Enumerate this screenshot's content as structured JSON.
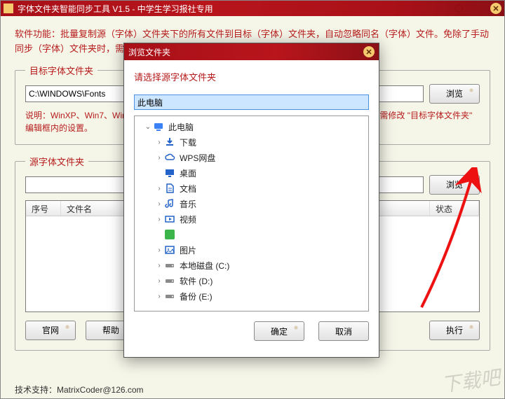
{
  "window": {
    "title": "字体文件夹智能同步工具 V1.5 - 中学生学习报社专用",
    "description": "软件功能：批量复制源（字体）文件夹下的所有文件到目标（字体）文件夹，自动忽略同名（字体）文件。免除了手动同步（字体）文件夹时，需要频繁确认是否需要替换同名（字体）文件的烦恼。"
  },
  "target_group": {
    "legend": "目标字体文件夹",
    "path_value": "C:\\WINDOWS\\Fonts",
    "browse_label": "浏览",
    "note": "说明：WinXP、Win7、Win8、Win10 的默认系统字体文件夹路径均为 C:\\WINDOWS\\Fonts，无需修改 \"目标字体文件夹\" 编辑框内的设置。"
  },
  "source_group": {
    "legend": "源字体文件夹",
    "path_value": "",
    "browse_label": "浏览",
    "columns": {
      "num": "序号",
      "name": "文件名",
      "status": "状态"
    }
  },
  "buttons": {
    "site": "官网",
    "help": "帮助",
    "execute": "执行"
  },
  "footer": "技术支持：MatrixCoder@126.com",
  "modal": {
    "title": "浏览文件夹",
    "prompt": "请选择源字体文件夹",
    "input_value": "此电脑",
    "ok": "确定",
    "cancel": "取消",
    "tree": [
      {
        "label": "此电脑",
        "icon": "pc",
        "level": 1,
        "expanded": true
      },
      {
        "label": "下载",
        "icon": "download",
        "level": 2,
        "expandable": true
      },
      {
        "label": "WPS网盘",
        "icon": "cloud",
        "level": 2,
        "expandable": true
      },
      {
        "label": "桌面",
        "icon": "desktop",
        "level": 2,
        "expandable": false
      },
      {
        "label": "文档",
        "icon": "doc",
        "level": 2,
        "expandable": true
      },
      {
        "label": "音乐",
        "icon": "music",
        "level": 2,
        "expandable": true
      },
      {
        "label": "视频",
        "icon": "video",
        "level": 2,
        "expandable": true
      },
      {
        "label": "",
        "icon": "green",
        "level": 2,
        "expandable": false
      },
      {
        "label": "图片",
        "icon": "image",
        "level": 2,
        "expandable": true
      },
      {
        "label": "本地磁盘 (C:)",
        "icon": "drive",
        "level": 2,
        "expandable": true
      },
      {
        "label": "软件 (D:)",
        "icon": "drive",
        "level": 2,
        "expandable": true
      },
      {
        "label": "备份 (E:)",
        "icon": "drive",
        "level": 2,
        "expandable": true
      }
    ]
  },
  "watermark": "下载吧"
}
